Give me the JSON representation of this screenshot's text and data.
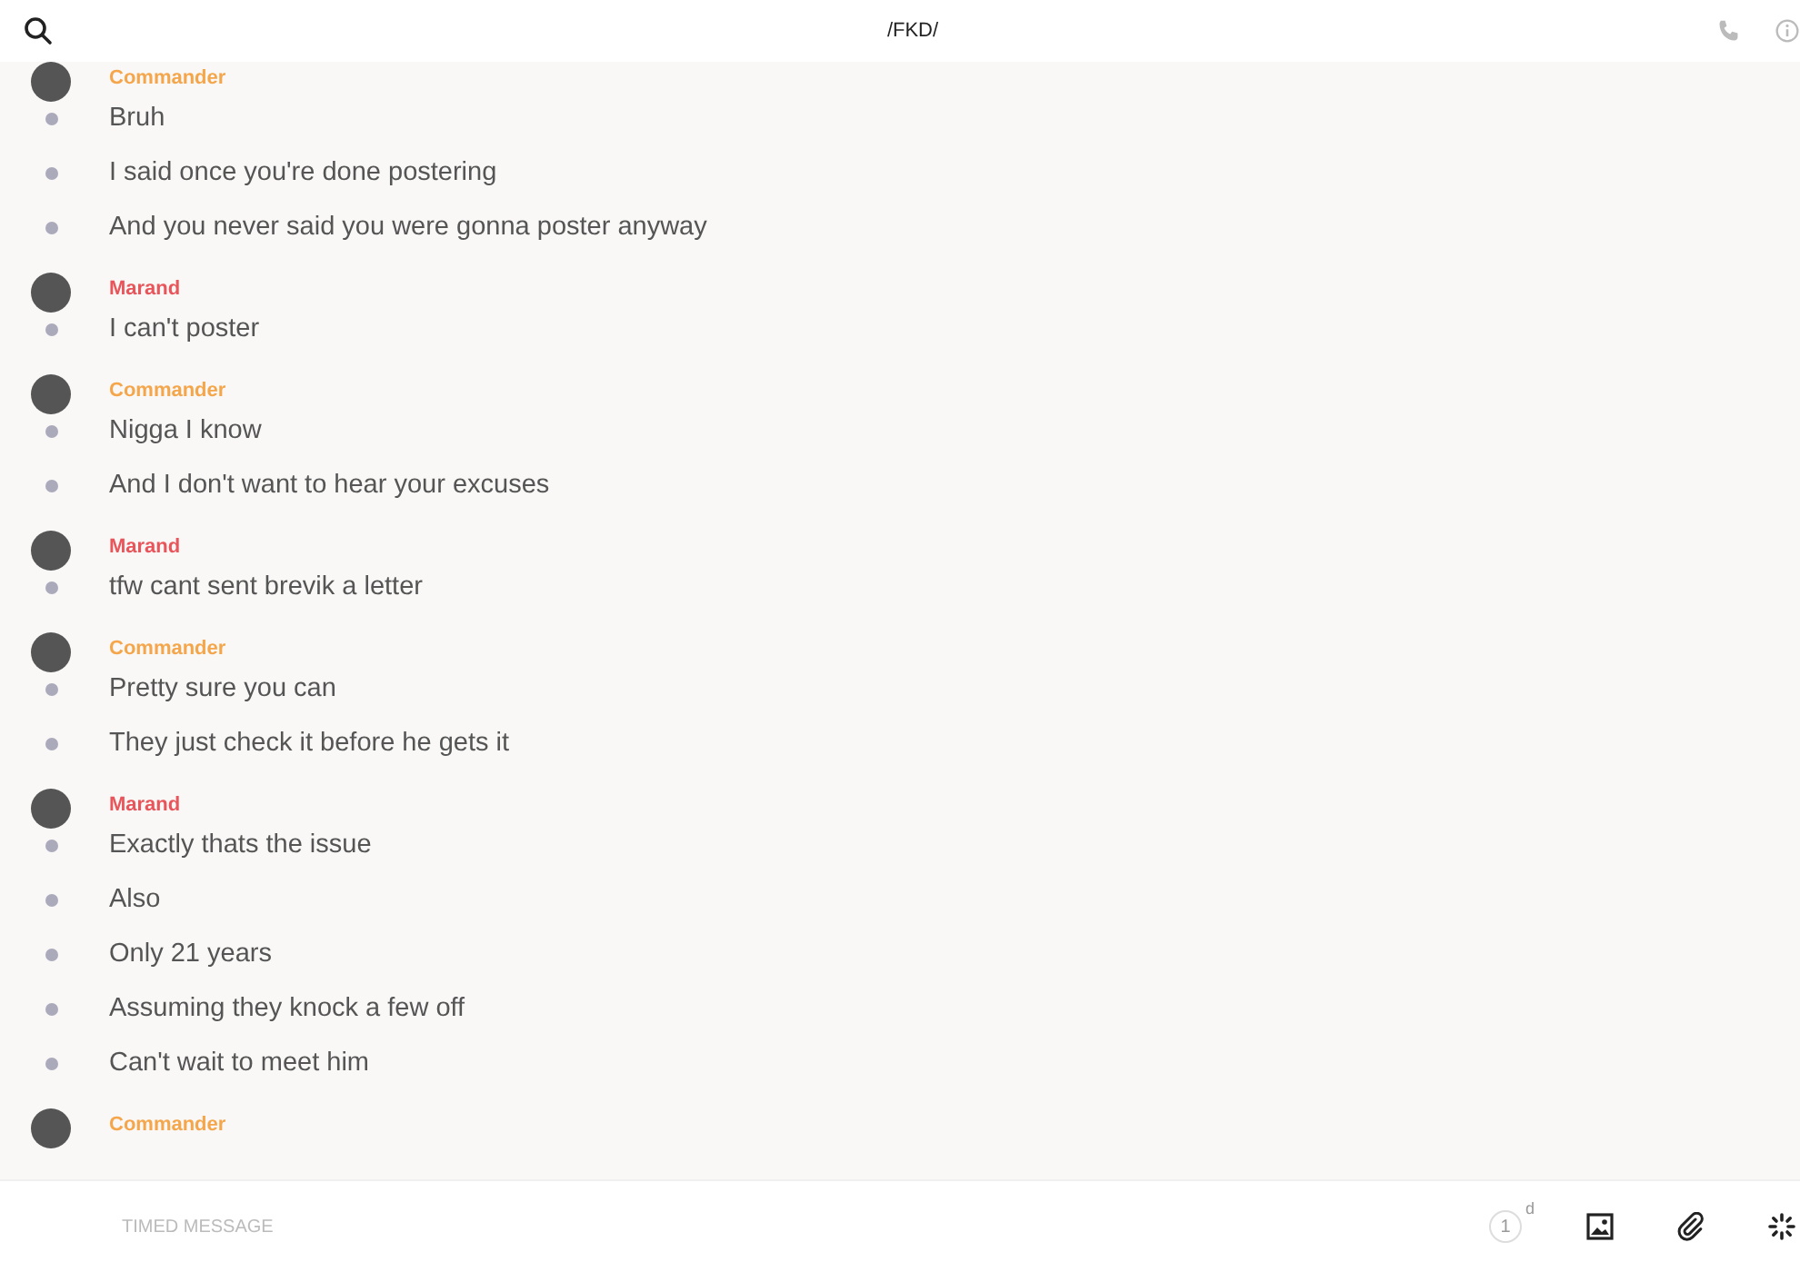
{
  "header": {
    "title": "/FKD/"
  },
  "groups": [
    {
      "sender": "Commander",
      "color": "#f5a54a",
      "messages": [
        "Bruh",
        "I said once you're done postering",
        "And you never said you were gonna poster anyway"
      ]
    },
    {
      "sender": "Marand",
      "color": "#e8555a",
      "messages": [
        "I can't poster"
      ]
    },
    {
      "sender": "Commander",
      "color": "#f5a54a",
      "messages": [
        "Nigga I know",
        "And I don't want to hear your excuses"
      ]
    },
    {
      "sender": "Marand",
      "color": "#e8555a",
      "messages": [
        "tfw cant sent brevik a letter"
      ]
    },
    {
      "sender": "Commander",
      "color": "#f5a54a",
      "messages": [
        "Pretty sure you can",
        "They just check it before he gets it"
      ]
    },
    {
      "sender": "Marand",
      "color": "#e8555a",
      "messages": [
        "Exactly thats the issue",
        "Also",
        "Only 21 years",
        "Assuming they knock a few off",
        "Can't wait to meet him"
      ]
    },
    {
      "sender": "Commander",
      "color": "#f5a54a"
    }
  ],
  "composer": {
    "placeholder": "TIMED MESSAGE",
    "timer_value": "1",
    "timer_unit": "d"
  }
}
